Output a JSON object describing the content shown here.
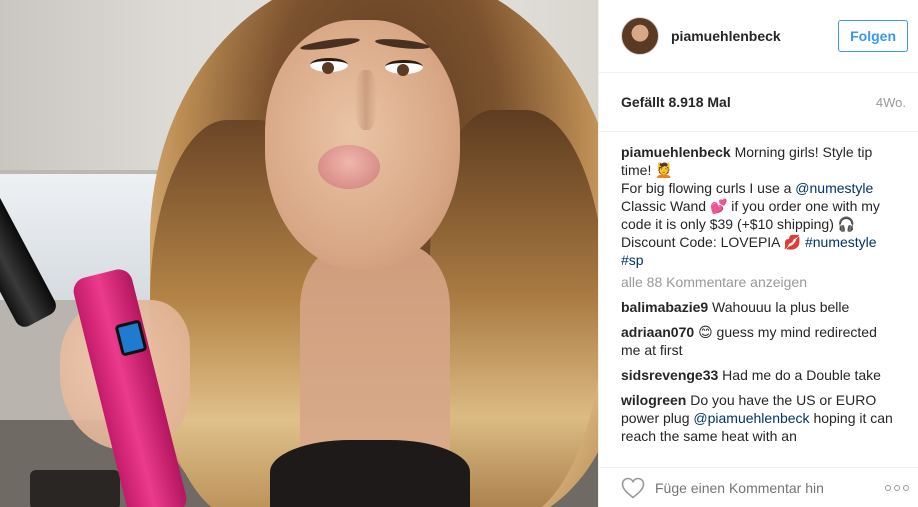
{
  "post": {
    "username": "piamuehlenbeck",
    "follow_label": "Folgen",
    "likes": "Gefällt 8.918 Mal",
    "age": "4Wo."
  },
  "caption": {
    "username": "piamuehlenbeck",
    "line1": " Morning girls! Style tip time! ",
    "line1_emoji": "💆",
    "line2_a": "For big flowing curls I use a ",
    "mention1": "@numestyle",
    "line2_b": " Classic Wand ",
    "emoji_hearts": "💕",
    "line2_c": " if you order one with my code it is only $39 (+$10 shipping) ",
    "emoji_headphones": "🎧",
    "line3_a": "Discount Code: LOVEPIA ",
    "emoji_lips": "💋",
    "hashtag1": "#numestyle",
    "hashtag2": "#sp"
  },
  "view_all_comments": "alle 88 Kommentare anzeigen",
  "comments": [
    {
      "username": "balimabazie9",
      "text": " Wahouuu la plus belle"
    },
    {
      "username": "adriaan070",
      "emoji": "😊",
      "text": " guess my mind redirected me at first"
    },
    {
      "username": "sidsrevenge33",
      "text": " Had me do a Double take"
    },
    {
      "username": "wilogreen",
      "text_a": " Do you have the US or EURO power plug ",
      "mention": "@piamuehlenbeck",
      "text_b": " hoping it can reach the same heat with an"
    }
  ],
  "footer": {
    "add_comment_placeholder": "Füge einen Kommentar hin"
  },
  "icons": {
    "like": "heart-icon",
    "more": "more-options-icon"
  },
  "colors": {
    "accent": "#3897f0",
    "link": "#003569",
    "muted": "#999999"
  }
}
